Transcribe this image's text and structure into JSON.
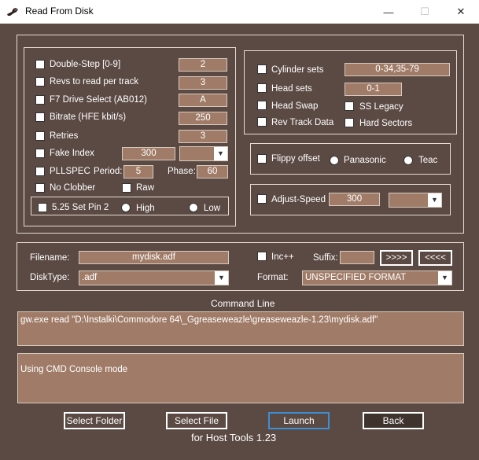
{
  "window": {
    "title": "Read From Disk",
    "minimize_glyph": "—",
    "maximize_glyph": "☐",
    "close_glyph": "✕"
  },
  "colors": {
    "background": "#5b4a43",
    "field": "#a07c68",
    "border": "#e6dcd4",
    "focus": "#3d8fd6"
  },
  "left_group": {
    "double_step": {
      "label": "Double-Step [0-9]",
      "checked": false,
      "value": "2"
    },
    "revs": {
      "label": "Revs to read per track",
      "checked": false,
      "value": "3"
    },
    "f7_drive": {
      "label": "F7 Drive Select (AB012)",
      "checked": false,
      "value": "A"
    },
    "bitrate": {
      "label": "Bitrate (HFE kbit/s)",
      "checked": false,
      "value": "250"
    },
    "retries": {
      "label": "Retries",
      "checked": false,
      "value": "3"
    },
    "fake_index": {
      "label": "Fake Index",
      "checked": false,
      "value": "300",
      "unit_select": ""
    },
    "pllspec": {
      "label": "PLLSPEC",
      "checked": false,
      "period_label": "Period:",
      "period": "5",
      "phase_label": "Phase:",
      "phase": "60"
    },
    "no_clobber": {
      "label": "No Clobber",
      "checked": false
    },
    "raw": {
      "label": "Raw",
      "checked": false
    },
    "set_pin2": {
      "label": "5.25 Set Pin 2",
      "checked": false,
      "high_label": "High",
      "low_label": "Low"
    }
  },
  "right_group": {
    "cylinder_sets": {
      "label": "Cylinder sets",
      "checked": false,
      "value": "0-34,35-79"
    },
    "head_sets": {
      "label": "Head sets",
      "checked": false,
      "value": "0-1"
    },
    "head_swap": {
      "label": "Head Swap",
      "checked": false
    },
    "ss_legacy": {
      "label": "SS Legacy",
      "checked": false
    },
    "rev_track_data": {
      "label": "Rev Track Data",
      "checked": false
    },
    "hard_sectors": {
      "label": "Hard Sectors",
      "checked": false
    },
    "flippy": {
      "label": "Flippy offset",
      "checked": false,
      "panasonic_label": "Panasonic",
      "teac_label": "Teac"
    },
    "adjust_speed": {
      "label": "Adjust-Speed",
      "checked": false,
      "value": "300",
      "unit_select": ""
    }
  },
  "file_group": {
    "filename_label": "Filename:",
    "filename": "mydisk.adf",
    "inc_label": "Inc++",
    "suffix_label": "Suffix:",
    "suffix": "",
    "next_label": ">>>>",
    "prev_label": "<<<<",
    "disktype_label": "DiskType:",
    "disktype": ".adf",
    "format_label": "Format:",
    "format": "UNSPECIFIED FORMAT"
  },
  "command": {
    "heading": "Command Line",
    "text": "gw.exe read \"D:\\Instalki\\Commodore 64\\_Ggreaseweazle\\greaseweazle-1.23\\mydisk.adf\"",
    "console_text": "Using CMD Console mode"
  },
  "buttons": {
    "select_folder": "Select Folder",
    "select_file": "Select File",
    "launch": "Launch",
    "back": "Back"
  },
  "footer": "for Host Tools 1.23"
}
